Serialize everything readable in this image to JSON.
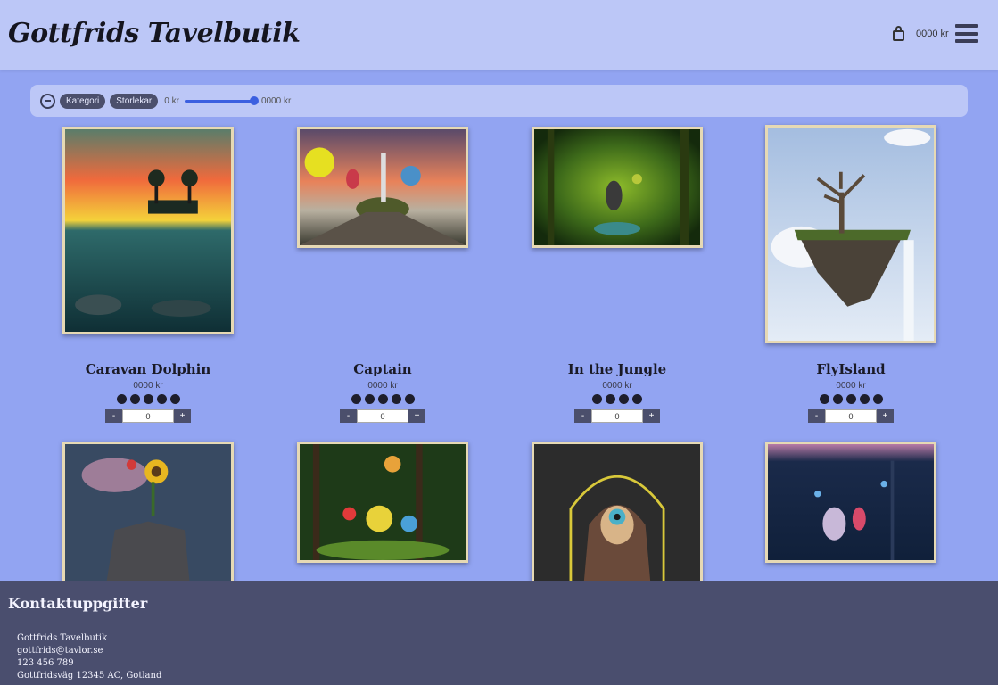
{
  "header": {
    "brand": "Gottfrids Tavelbutik",
    "cart_total": "0000 kr"
  },
  "filter": {
    "chips": [
      "Kategori",
      "Storlekar"
    ],
    "price_min": "0 kr",
    "price_max": "0000 kr",
    "slider_value_fraction": 1.0
  },
  "products": [
    {
      "title": "Caravan Dolphin",
      "price": "0000 kr",
      "rating_stars": 5,
      "quantity": "0",
      "scene": "dolphin"
    },
    {
      "title": "Captain",
      "price": "0000 kr",
      "rating_stars": 5,
      "quantity": "0",
      "scene": "captain"
    },
    {
      "title": "In the Jungle",
      "price": "0000 kr",
      "rating_stars": 4,
      "quantity": "0",
      "scene": "jungle"
    },
    {
      "title": "FlyIsland",
      "price": "0000 kr",
      "rating_stars": 5,
      "quantity": "0",
      "scene": "island"
    },
    {
      "title": "",
      "price": "",
      "rating_stars": 0,
      "quantity": "",
      "scene": "sunflower"
    },
    {
      "title": "",
      "price": "",
      "rating_stars": 0,
      "quantity": "",
      "scene": "forest"
    },
    {
      "title": "",
      "price": "",
      "rating_stars": 0,
      "quantity": "",
      "scene": "portrait"
    },
    {
      "title": "",
      "price": "",
      "rating_stars": 0,
      "quantity": "",
      "scene": "aquarium"
    }
  ],
  "qty_controls": {
    "minus": "-",
    "plus": "+"
  },
  "footer": {
    "heading": "Kontaktuppgifter",
    "lines": [
      "Gottfrids Tavelbutik",
      "gottfrids@tavlor.se",
      "123 456 789",
      "Gottfridsväg 12345 AC, Gotland"
    ]
  },
  "colors": {
    "page_bg": "#92a4f2",
    "header_bg": "#bcc7f7",
    "footer_bg": "#4a4e6e",
    "accent": "#3b5fe0"
  }
}
